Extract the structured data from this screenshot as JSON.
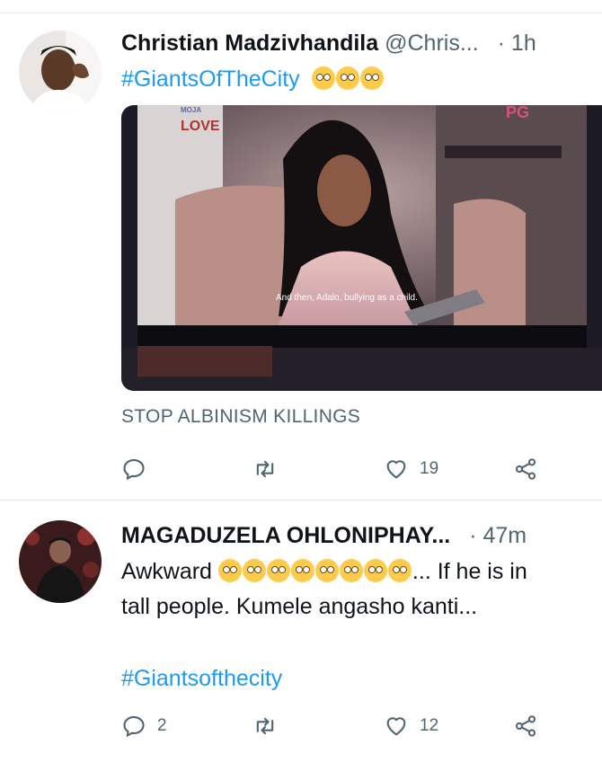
{
  "tweets": [
    {
      "author_name": "Christian Madzivhandila",
      "handle": "@Chris...",
      "separator": "·",
      "time": "1h",
      "hashtag": "#GiantsOfTheCity",
      "media": {
        "logo_top": "MOJA",
        "logo_bottom": "LOVE",
        "rating": "PG",
        "subtitle": "And then, Adalo, bullying as a child."
      },
      "caption": "STOP ALBINISM KILLINGS",
      "actions": {
        "reply": "",
        "retweet": "",
        "like": "19"
      }
    },
    {
      "author_name": "MAGADUZELA OHLONIPHAY...",
      "separator": "·",
      "time": "47m",
      "text_line1_start": "Awkward ",
      "text_line1_end": "... If he is in",
      "text_line2": "tall people. Kumele angasho kanti...",
      "hashtag": "#Giantsofthecity",
      "actions": {
        "reply": "2",
        "retweet": "",
        "like": "12"
      }
    }
  ],
  "icons": [
    "reply-icon",
    "retweet-icon",
    "like-icon",
    "share-icon",
    "flushed-face-emoji",
    "pleading-face-emoji",
    "thinking-face-emoji"
  ],
  "colors": {
    "link": "#1d9bf0",
    "secondary": "#536471",
    "divider": "#e7e9ec"
  }
}
